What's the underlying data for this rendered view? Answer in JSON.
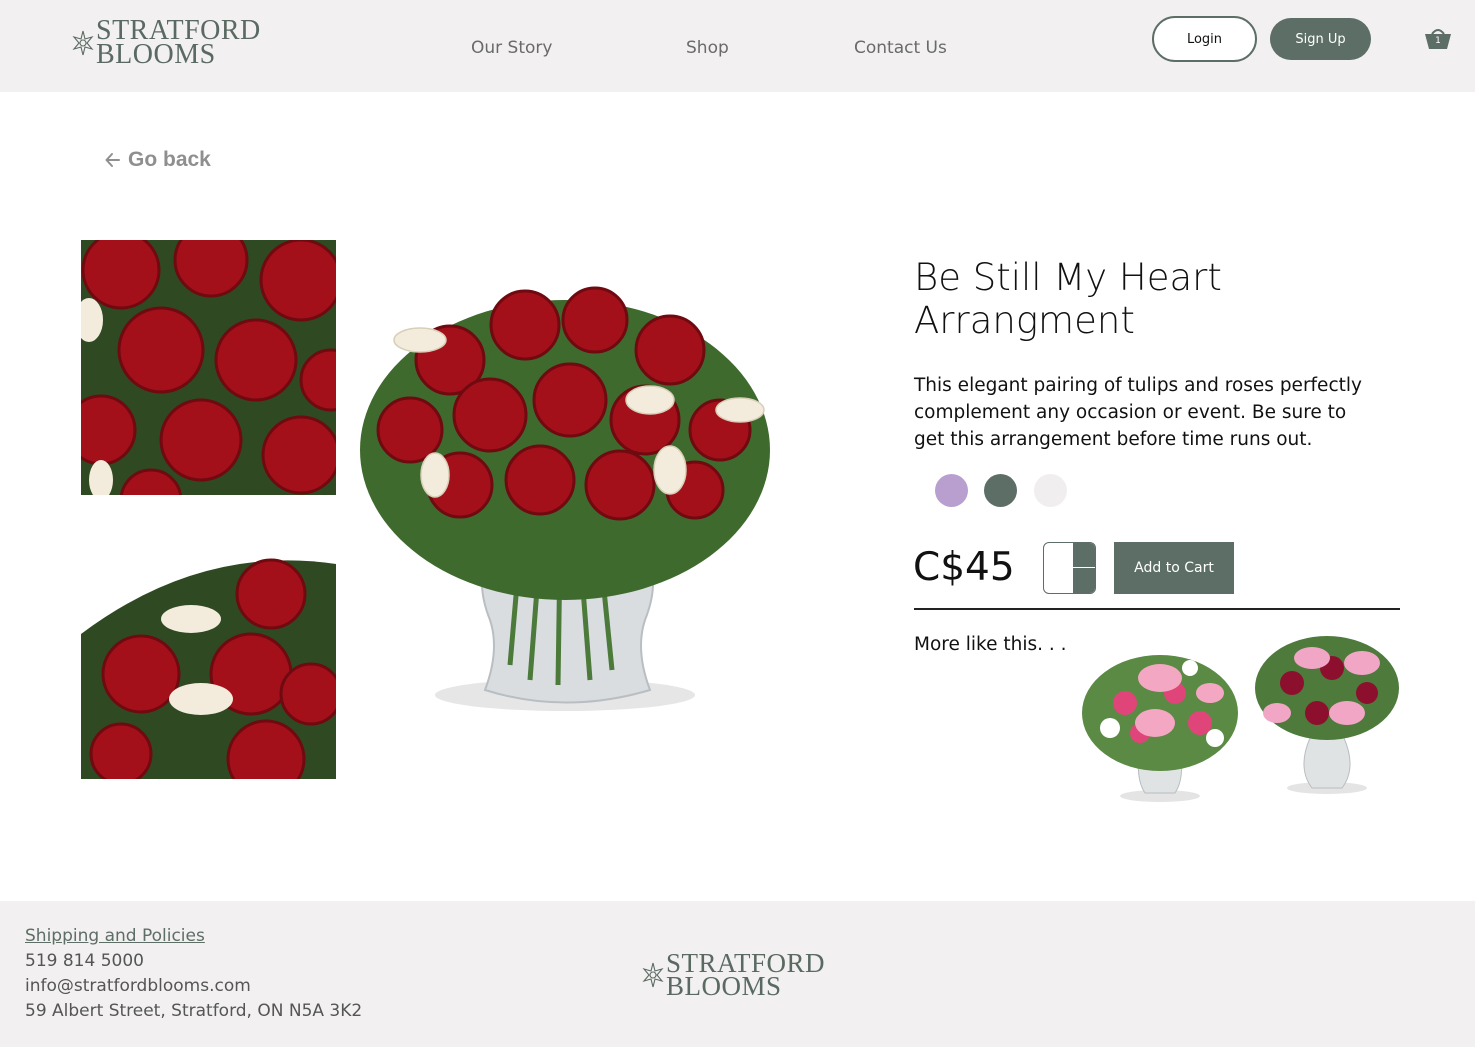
{
  "brand": {
    "line1": "STRATFORD",
    "line2": "BLOOMS"
  },
  "nav": [
    {
      "label": "Our Story"
    },
    {
      "label": "Shop"
    },
    {
      "label": "Contact Us"
    }
  ],
  "auth": {
    "login": "Login",
    "signup": "Sign Up"
  },
  "cart": {
    "count": "1",
    "icon": "basket-icon"
  },
  "back": {
    "label": "Go back",
    "icon": "arrow-left-icon"
  },
  "product": {
    "title_line1": "Be Still My Heart",
    "title_line2": "Arrangment",
    "description": "This elegant pairing of tulips and roses perfectly complement any occasion or event.  Be sure to get this arrangement before time runs out.",
    "colors": [
      "#b89fcf",
      "#5d6e66",
      "#f0eeee"
    ],
    "price": "C$45",
    "add_to_cart": "Add to Cart",
    "more_like_this": "More like this. . ."
  },
  "footer": {
    "policies": "Shipping and  Policies ",
    "phone": "519 814 5000",
    "email": "info@stratfordblooms.com",
    "address": "59 Albert Street, Stratford, ON  N5A 3K2"
  },
  "theme": {
    "accent": "#5d6e66",
    "header_bg": "#f2f0f0",
    "rose": "#a3101a"
  }
}
